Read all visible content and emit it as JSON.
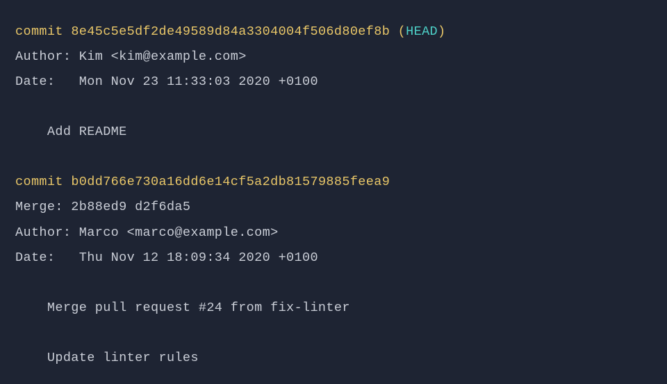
{
  "commits": [
    {
      "commit_label": "commit ",
      "hash": "8e45c5e5df2de49589d84a3304004f506d80ef8b",
      "ref_open": " (",
      "ref_name": "HEAD",
      "ref_close": ")",
      "author_line": "Author: Kim <kim@example.com>",
      "date_line": "Date:   Mon Nov 23 11:33:03 2020 +0100",
      "message_lines": [
        "    Add README"
      ]
    },
    {
      "commit_label": "commit ",
      "hash": "b0dd766e730a16dd6e14cf5a2db81579885feea9",
      "merge_line": "Merge: 2b88ed9 d2f6da5",
      "author_line": "Author: Marco <marco@example.com>",
      "date_line": "Date:   Thu Nov 12 18:09:34 2020 +0100",
      "message_lines": [
        "    Merge pull request #24 from fix-linter",
        "",
        "    Update linter rules"
      ]
    }
  ]
}
